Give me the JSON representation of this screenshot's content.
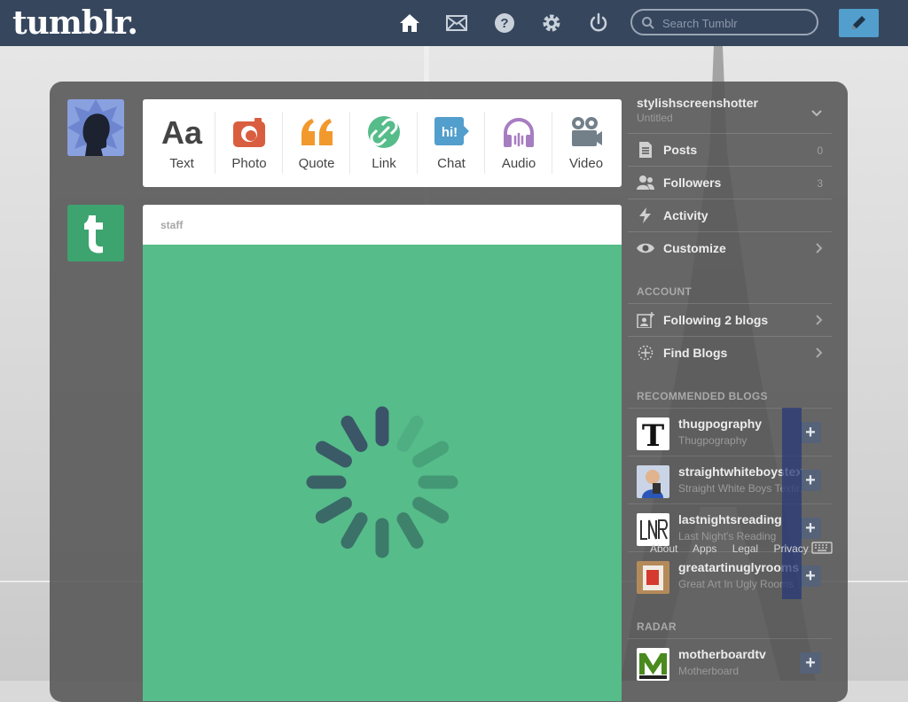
{
  "topbar": {
    "logo": "tumblr.",
    "nav_icons": [
      "home-icon",
      "mail-icon",
      "help-icon",
      "settings-icon",
      "power-icon"
    ],
    "search_placeholder": "Search Tumblr",
    "compose_icon": "pencil-icon",
    "colors": {
      "bar": "#36465d",
      "compose": "#529ecc"
    }
  },
  "post_types": [
    {
      "label": "Text",
      "icon": "text-aa-icon",
      "color": "#444444"
    },
    {
      "label": "Photo",
      "icon": "camera-icon",
      "color": "#d95e40"
    },
    {
      "label": "Quote",
      "icon": "quote-icon",
      "color": "#f2992e"
    },
    {
      "label": "Link",
      "icon": "link-icon",
      "color": "#56bc8a"
    },
    {
      "label": "Chat",
      "icon": "chat-bubble-icon",
      "color": "#529ecc"
    },
    {
      "label": "Audio",
      "icon": "headphones-icon",
      "color": "#a77dc2"
    },
    {
      "label": "Video",
      "icon": "video-camera-icon",
      "color": "#748089"
    }
  ],
  "post": {
    "author": "staff",
    "media_color": "#56bc8a",
    "loading": "spinner-icon"
  },
  "sidebar": {
    "blog_name": "stylishscreenshotter",
    "blog_title": "Untitled",
    "items": [
      {
        "label": "Posts",
        "count": "0",
        "icon": "posts-icon"
      },
      {
        "label": "Followers",
        "count": "3",
        "icon": "followers-icon"
      },
      {
        "label": "Activity",
        "icon": "activity-icon"
      },
      {
        "label": "Customize",
        "icon": "eye-icon"
      }
    ],
    "account_heading": "ACCOUNT",
    "account_items": [
      {
        "label": "Following 2 blogs",
        "icon": "following-icon"
      },
      {
        "label": "Find Blogs",
        "icon": "find-blogs-icon"
      }
    ],
    "recommended_heading": "RECOMMENDED BLOGS",
    "recommended": [
      {
        "name": "thugpography",
        "title": "Thugpography"
      },
      {
        "name": "straightwhiteboystexting",
        "title": "Straight White Boys Texting"
      },
      {
        "name": "lastnightsreading",
        "title": "Last Night's Reading"
      },
      {
        "name": "greatartinuglyrooms",
        "title": "Great Art In Ugly Rooms"
      }
    ],
    "radar_heading": "RADAR",
    "radar": [
      {
        "name": "motherboardtv",
        "title": "Motherboard"
      }
    ],
    "add_label": "+"
  },
  "footer": {
    "links": [
      "About",
      "Apps",
      "Legal",
      "Privacy"
    ]
  }
}
